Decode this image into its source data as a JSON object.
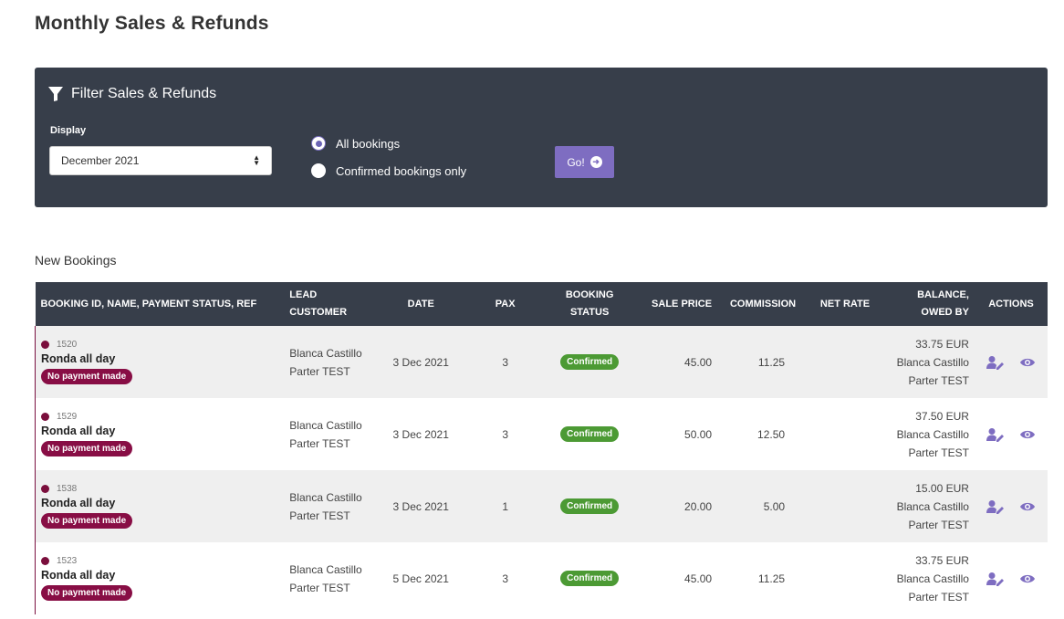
{
  "page": {
    "title": "Monthly Sales & Refunds"
  },
  "filter": {
    "title": "Filter Sales & Refunds",
    "display_label": "Display",
    "selected_month": "December 2021",
    "radio_all": "All bookings",
    "radio_confirmed": "Confirmed bookings only",
    "selected_radio": "All bookings",
    "go_label": "Go!"
  },
  "section": {
    "title": "New Bookings"
  },
  "table": {
    "headers": {
      "booking": "BOOKING ID, NAME, PAYMENT STATUS, REF",
      "lead_line1": "LEAD",
      "lead_line2": "CUSTOMER",
      "date": "DATE",
      "pax": "PAX",
      "status_line1": "BOOKING",
      "status_line2": "STATUS",
      "sale_price": "SALE PRICE",
      "commission": "COMMISSION",
      "net_rate": "NET RATE",
      "balance_line1": "BALANCE,",
      "balance_line2": "OWED BY",
      "actions": "ACTIONS"
    },
    "rows": [
      {
        "id": "1520",
        "name": "Ronda all day",
        "payment": "No payment made",
        "lead1": "Blanca Castillo",
        "lead2": "Parter TEST",
        "date": "3 Dec 2021",
        "pax": "3",
        "status": "Confirmed",
        "sale": "45.00",
        "commission": "11.25",
        "net": "",
        "balance": "33.75 EUR",
        "owed1": "Blanca Castillo",
        "owed2": "Parter TEST"
      },
      {
        "id": "1529",
        "name": "Ronda all day",
        "payment": "No payment made",
        "lead1": "Blanca Castillo",
        "lead2": "Parter TEST",
        "date": "3 Dec 2021",
        "pax": "3",
        "status": "Confirmed",
        "sale": "50.00",
        "commission": "12.50",
        "net": "",
        "balance": "37.50 EUR",
        "owed1": "Blanca Castillo",
        "owed2": "Parter TEST"
      },
      {
        "id": "1538",
        "name": "Ronda all day",
        "payment": "No payment made",
        "lead1": "Blanca Castillo",
        "lead2": "Parter TEST",
        "date": "3 Dec 2021",
        "pax": "1",
        "status": "Confirmed",
        "sale": "20.00",
        "commission": "5.00",
        "net": "",
        "balance": "15.00 EUR",
        "owed1": "Blanca Castillo",
        "owed2": "Parter TEST"
      },
      {
        "id": "1523",
        "name": "Ronda all day",
        "payment": "No payment made",
        "lead1": "Blanca Castillo",
        "lead2": "Parter TEST",
        "date": "5 Dec 2021",
        "pax": "3",
        "status": "Confirmed",
        "sale": "45.00",
        "commission": "11.25",
        "net": "",
        "balance": "33.75 EUR",
        "owed1": "Blanca Castillo",
        "owed2": "Parter TEST"
      }
    ]
  },
  "icons": {
    "filter": "filter-icon",
    "edit_user": "user-edit-icon",
    "view": "eye-icon",
    "go": "arrow-circle-right-icon"
  },
  "colors": {
    "panel": "#373e4a",
    "accent": "#7e6dc1",
    "payment_badge": "#880e45",
    "confirmed_badge": "#4c9a34"
  }
}
